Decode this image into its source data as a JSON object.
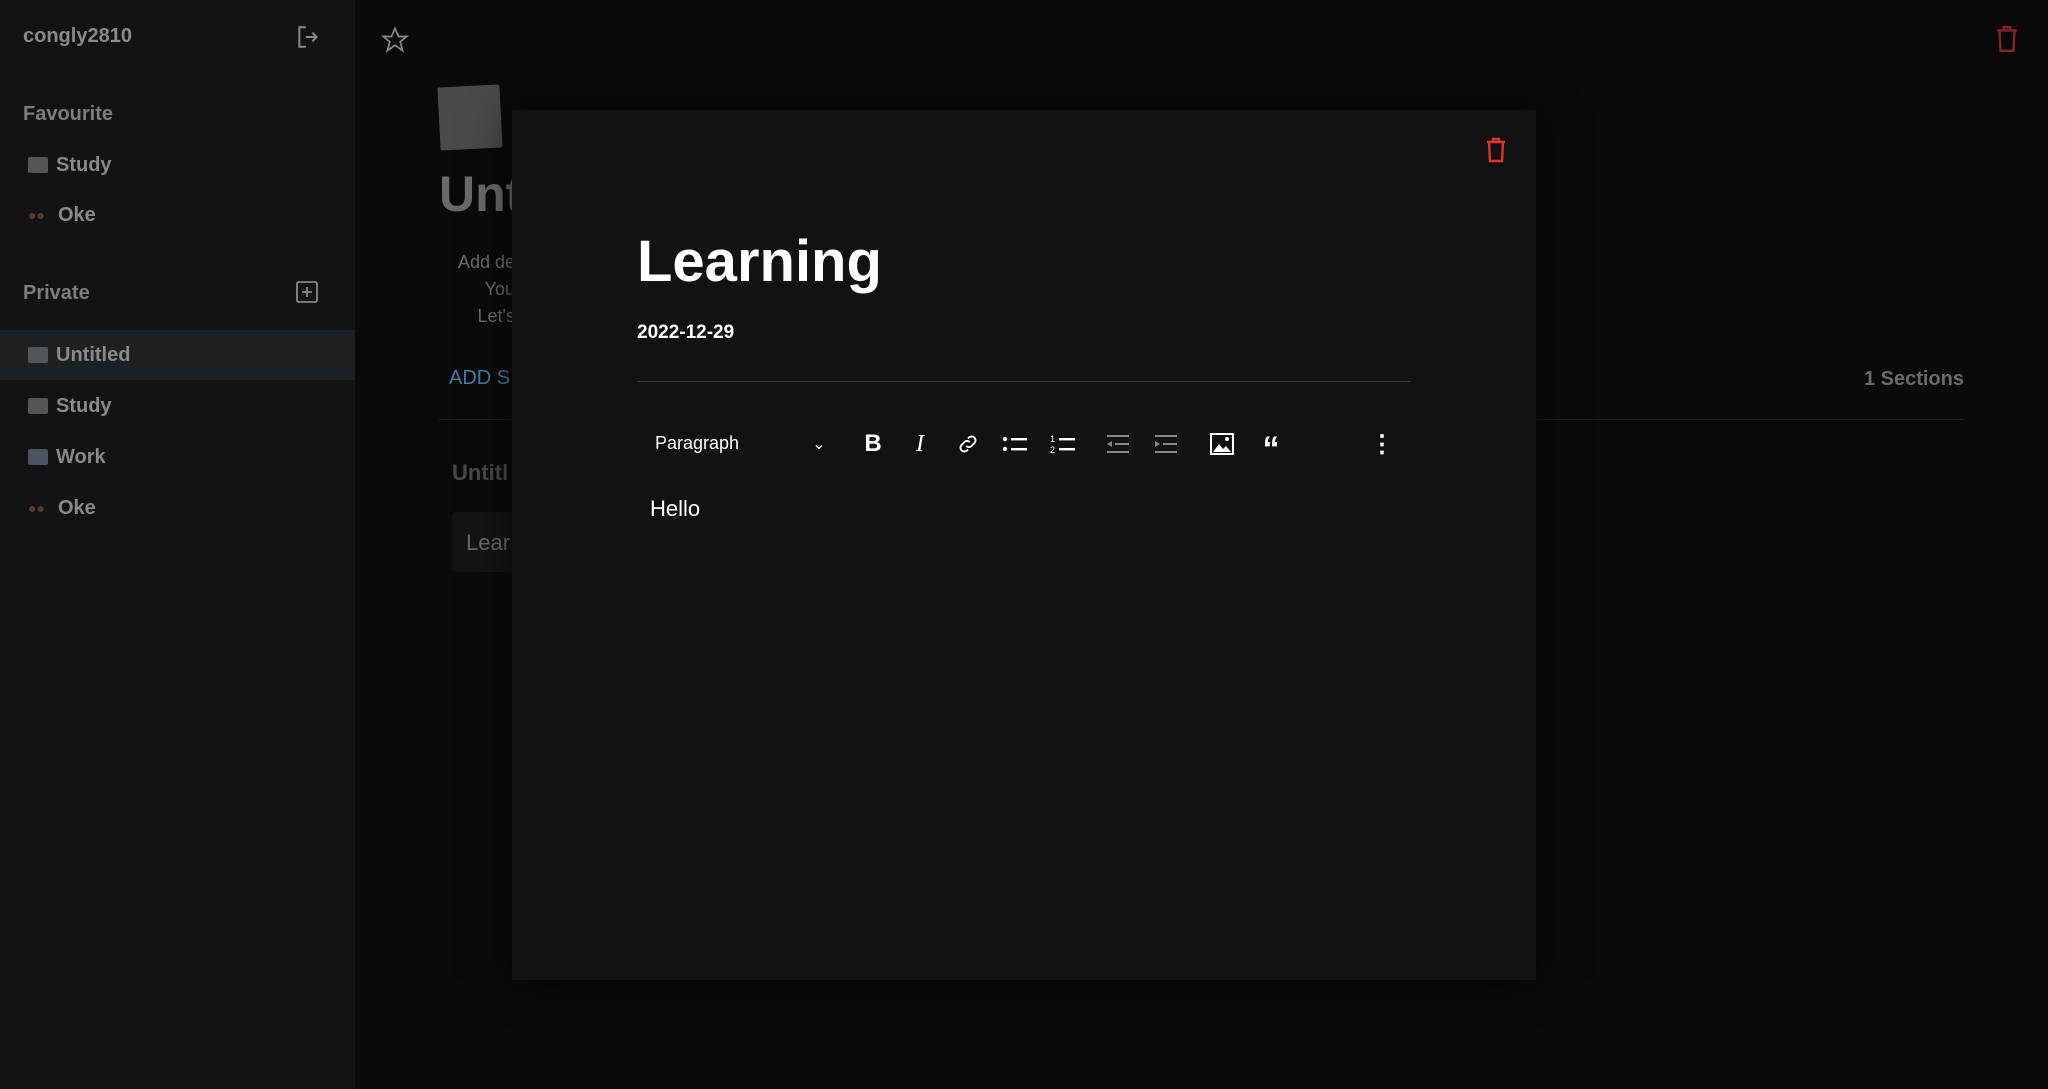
{
  "sidebar": {
    "username": "congly2810",
    "favourite_label": "Favourite",
    "favourites": [
      {
        "icon": "page-icon",
        "label": "Study"
      },
      {
        "icon": "glasses-icon",
        "label": "Oke"
      }
    ],
    "private_label": "Private",
    "private": [
      {
        "icon": "page-icon",
        "label": "Untitled",
        "selected": true
      },
      {
        "icon": "page-icon",
        "label": "Study"
      },
      {
        "icon": "office-icon",
        "label": "Work"
      },
      {
        "icon": "glasses-icon",
        "label": "Oke"
      }
    ]
  },
  "main": {
    "title_fragment": "Unt",
    "description_fragments": [
      "Add de",
      "You",
      "Let's"
    ],
    "add_section_fragment": "ADD S",
    "sections_count": "1 Sections",
    "section_title_fragment": "Untitl",
    "card_fragment": "Lear"
  },
  "modal": {
    "title": "Learning",
    "date": "2022-12-29",
    "block_type": "Paragraph",
    "content": "Hello"
  },
  "colors": {
    "delete": "#e0332e",
    "accent_link": "#4a7aa0"
  }
}
